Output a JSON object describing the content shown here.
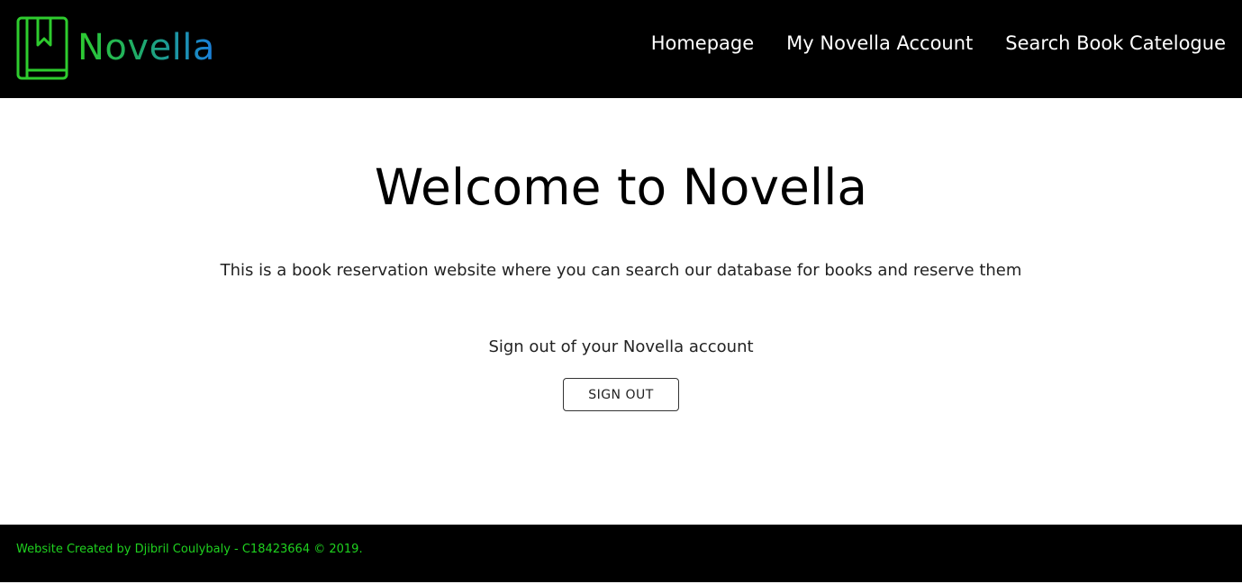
{
  "header": {
    "logo_text": "Novella",
    "logo_icon": "bookmark-book-icon",
    "nav": [
      {
        "label": "Homepage"
      },
      {
        "label": "My Novella Account"
      },
      {
        "label": "Search Book Catelogue"
      }
    ]
  },
  "main": {
    "title": "Welcome to Novella",
    "intro": "This is a book reservation website where you can search our database for books and reserve them",
    "signout_prompt": "Sign out of your Novella account",
    "signout_button": "SIGN OUT"
  },
  "footer": {
    "text": "Website Created by Djibril Coulybaly - C18423664 © 2019."
  },
  "colors": {
    "header_bg": "#000000",
    "logo_green": "#2ecc2e",
    "logo_blue": "#1a7fe0",
    "footer_text": "#1fd21f"
  }
}
